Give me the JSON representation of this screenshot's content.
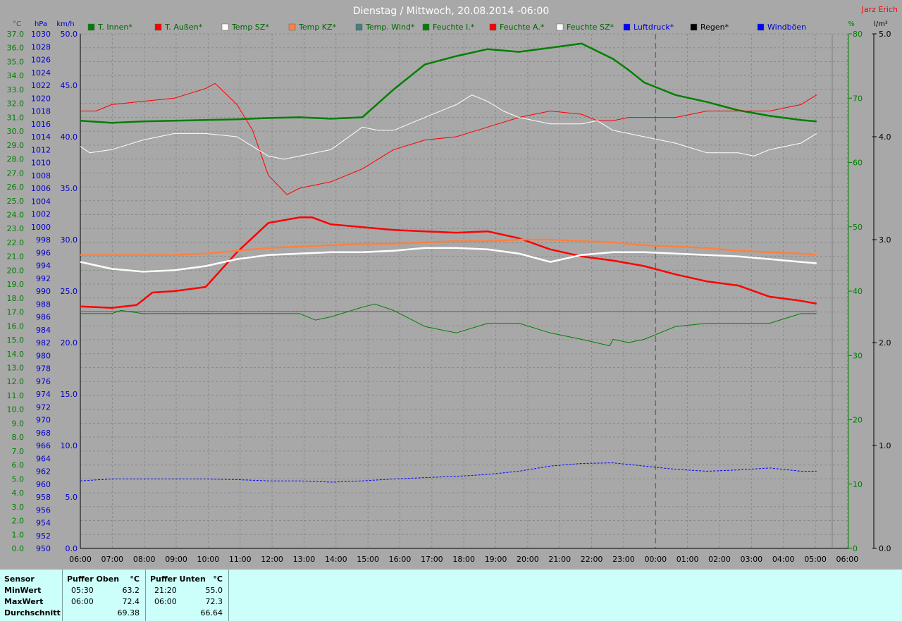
{
  "title": "Dienstag / Mittwoch, 20.08.2014  -06:00",
  "user": "Jarz Erich",
  "legend": [
    {
      "label": "T. Innen*",
      "color": "#008000"
    },
    {
      "label": "T. Außen*",
      "color": "#ff0000"
    },
    {
      "label": "Temp SZ*",
      "color": "#ffffff"
    },
    {
      "label": "Temp KZ*",
      "color": "#ff8040"
    },
    {
      "label": "Temp. Wind*",
      "color": "#408080"
    },
    {
      "label": "Feuchte I.*",
      "color": "#008000"
    },
    {
      "label": "Feuchte A.*",
      "color": "#ff0000"
    },
    {
      "label": "Feuchte SZ*",
      "color": "#ffffff"
    },
    {
      "label": "Luftdruck*",
      "color": "#0000ff"
    },
    {
      "label": "Regen*",
      "color": "#000000"
    },
    {
      "label": "Windböen",
      "color": "#0000ff"
    }
  ],
  "axes": {
    "temp_unit": "°C",
    "pressure_unit": "hPa",
    "wind_unit": "km/h",
    "humidity_unit": "%",
    "rain_unit": "l/m²",
    "temp_ticks": [
      "0.0",
      "1.0",
      "2.0",
      "3.0",
      "4.0",
      "5.0",
      "6.0",
      "7.0",
      "8.0",
      "9.0",
      "10.0",
      "11.0",
      "12.0",
      "13.0",
      "14.0",
      "15.0",
      "16.0",
      "17.0",
      "18.0",
      "19.0",
      "20.0",
      "21.0",
      "22.0",
      "23.0",
      "24.0",
      "25.0",
      "26.0",
      "27.0",
      "28.0",
      "29.0",
      "30.0",
      "31.0",
      "32.0",
      "33.0",
      "34.0",
      "35.0",
      "36.0",
      "37.0"
    ],
    "pressure_ticks": [
      "950",
      "952",
      "954",
      "956",
      "958",
      "960",
      "962",
      "964",
      "966",
      "968",
      "970",
      "972",
      "974",
      "976",
      "978",
      "980",
      "982",
      "984",
      "986",
      "988",
      "990",
      "992",
      "994",
      "996",
      "998",
      "1000",
      "1002",
      "1004",
      "1006",
      "1008",
      "1010",
      "1012",
      "1014",
      "1016",
      "1018",
      "1020",
      "1022",
      "1024",
      "1026",
      "1028",
      "1030"
    ],
    "wind_ticks": [
      "0.0",
      "5.0",
      "10.0",
      "15.0",
      "20.0",
      "25.0",
      "30.0",
      "35.0",
      "40.0",
      "45.0",
      "50.0"
    ],
    "humidity_ticks": [
      "0",
      "10",
      "20",
      "30",
      "40",
      "50",
      "60",
      "70",
      "80"
    ],
    "rain_ticks": [
      "0.0",
      "1.0",
      "2.0",
      "3.0",
      "4.0",
      "5.0"
    ],
    "time_ticks": [
      "06:00",
      "07:00",
      "08:00",
      "09:00",
      "10:00",
      "11:00",
      "12:00",
      "13:00",
      "14:00",
      "15:00",
      "16:00",
      "17:00",
      "18:00",
      "19:00",
      "20:00",
      "21:00",
      "22:00",
      "23:00",
      "00:00",
      "01:00",
      "02:00",
      "03:00",
      "04:00",
      "05:00",
      "06:00"
    ]
  },
  "chart_data": {
    "type": "line",
    "title": "Dienstag / Mittwoch, 20.08.2014  -06:00",
    "x_unit": "hours since 06:00",
    "xlim": [
      0,
      24
    ],
    "y_temp_lim": [
      0,
      37
    ],
    "y_pressure_lim": [
      950,
      1030
    ],
    "y_wind_lim": [
      0,
      50
    ],
    "y_humidity_lim": [
      0,
      80
    ],
    "y_rain_lim": [
      0,
      5
    ],
    "grid": true,
    "series": [
      {
        "name": "T. Innen*",
        "axis": "temp",
        "color": "#008000",
        "width": 2.5,
        "x": [
          0,
          1,
          2,
          3,
          4,
          5,
          6,
          7,
          8,
          9,
          10,
          11,
          12,
          13,
          14,
          15,
          16,
          17,
          17.5,
          18,
          19,
          20,
          21,
          22,
          23,
          23.5
        ],
        "y": [
          30.75,
          30.6,
          30.7,
          30.75,
          30.8,
          30.85,
          30.95,
          31.0,
          30.9,
          31.0,
          33.0,
          34.8,
          35.4,
          35.9,
          35.7,
          36.0,
          36.3,
          35.2,
          34.4,
          33.5,
          32.6,
          32.1,
          31.5,
          31.1,
          30.8,
          30.7
        ]
      },
      {
        "name": "T. Außen*",
        "axis": "temp",
        "color": "#ff0000",
        "width": 2.5,
        "x": [
          0,
          1,
          1.8,
          2.3,
          3,
          4,
          5,
          6,
          7,
          7.4,
          8,
          9,
          10,
          11,
          12,
          13,
          14,
          15,
          16,
          17,
          18,
          19,
          20,
          21,
          22,
          23,
          23.5
        ],
        "y": [
          17.4,
          17.3,
          17.5,
          18.4,
          18.5,
          18.8,
          21.3,
          23.4,
          23.8,
          23.8,
          23.3,
          23.1,
          22.9,
          22.8,
          22.7,
          22.8,
          22.3,
          21.5,
          21.0,
          20.7,
          20.3,
          19.7,
          19.2,
          18.9,
          18.1,
          17.8,
          17.6
        ]
      },
      {
        "name": "Temp SZ*",
        "axis": "temp",
        "color": "#ffffff",
        "width": 2.5,
        "x": [
          0,
          1,
          2,
          3,
          4,
          5,
          6,
          7,
          8,
          9,
          10,
          11,
          12,
          13,
          14,
          15,
          16,
          17,
          18,
          19,
          20,
          21,
          22,
          23,
          23.5
        ],
        "y": [
          20.6,
          20.1,
          19.9,
          20.0,
          20.3,
          20.8,
          21.1,
          21.2,
          21.3,
          21.3,
          21.4,
          21.6,
          21.6,
          21.5,
          21.2,
          20.6,
          21.1,
          21.3,
          21.3,
          21.2,
          21.1,
          21.0,
          20.8,
          20.6,
          20.5
        ]
      },
      {
        "name": "Temp KZ*",
        "axis": "temp",
        "color": "#ff8040",
        "width": 2.5,
        "x": [
          0,
          1,
          2,
          3,
          4,
          5,
          6,
          7,
          8,
          9,
          10,
          11,
          12,
          13,
          14,
          15,
          16,
          17,
          18,
          19,
          20,
          21,
          22,
          23,
          23.5
        ],
        "y": [
          21.1,
          21.1,
          21.1,
          21.1,
          21.2,
          21.4,
          21.6,
          21.7,
          21.8,
          21.9,
          21.9,
          22.0,
          22.1,
          22.1,
          22.2,
          22.2,
          22.1,
          22.0,
          21.8,
          21.7,
          21.6,
          21.4,
          21.3,
          21.2,
          21.1
        ]
      },
      {
        "name": "Temp. Wind*",
        "axis": "temp",
        "color": "#408080",
        "width": 1,
        "x": [
          0,
          23.5
        ],
        "y": [
          17.05,
          17.05
        ]
      },
      {
        "name": "Feuchte I.*",
        "axis": "humidity",
        "color": "#008000",
        "width": 1,
        "x": [
          0,
          1,
          1.3,
          2,
          4,
          6,
          7,
          7.5,
          8,
          9,
          9.4,
          10,
          11,
          12,
          13,
          14,
          15,
          16,
          16.9,
          17,
          17.5,
          18,
          19,
          20,
          21,
          22,
          23,
          23.5
        ],
        "y": [
          36.5,
          36.5,
          37.0,
          36.5,
          36.5,
          36.5,
          36.5,
          35.5,
          36.0,
          37.5,
          38.0,
          37.0,
          34.5,
          33.5,
          35.0,
          35.0,
          33.5,
          32.5,
          31.5,
          32.5,
          32.0,
          32.5,
          34.5,
          35.0,
          35.0,
          35.0,
          36.5,
          36.5
        ]
      },
      {
        "name": "Feuchte A.*",
        "axis": "humidity",
        "color": "#ff0000",
        "width": 1,
        "x": [
          0,
          0.5,
          1,
          2,
          3,
          4,
          4.3,
          5,
          5.5,
          6,
          6.6,
          7,
          8,
          9,
          10,
          11,
          12,
          13,
          14,
          15,
          16,
          16.5,
          17,
          17.5,
          18,
          19,
          20,
          21,
          22,
          23,
          23.5
        ],
        "y": [
          68.0,
          68.0,
          69.0,
          69.5,
          70.0,
          71.5,
          72.3,
          69.0,
          65.0,
          58.0,
          55.0,
          56.0,
          57.0,
          59.0,
          62.0,
          63.5,
          64.0,
          65.5,
          67.0,
          68.0,
          67.5,
          66.5,
          66.5,
          67.0,
          67.0,
          67.0,
          68.0,
          68.0,
          68.0,
          69.0,
          70.5
        ]
      },
      {
        "name": "Feuchte SZ*",
        "axis": "humidity",
        "color": "#ffffff",
        "width": 1,
        "x": [
          0,
          0.3,
          1,
          2,
          3,
          4,
          5,
          6,
          6.5,
          7,
          8,
          9,
          9.5,
          10,
          11,
          12,
          12.5,
          13,
          13.5,
          14,
          15,
          16,
          16.5,
          17,
          17.5,
          18,
          19,
          20,
          21,
          21.5,
          22,
          23,
          23.5
        ],
        "y": [
          62.5,
          61.5,
          62.0,
          63.5,
          64.5,
          64.5,
          64.0,
          61.0,
          60.5,
          61.0,
          62.0,
          65.5,
          65.0,
          65.0,
          67.0,
          69.0,
          70.5,
          69.5,
          68.0,
          67.0,
          66.0,
          66.0,
          66.5,
          65.0,
          64.5,
          64.0,
          63.0,
          61.5,
          61.5,
          61.0,
          62.0,
          63.0,
          64.5
        ]
      },
      {
        "name": "Luftdruck*",
        "axis": "pressure",
        "color": "#0000ff",
        "width": 1,
        "dashed": true,
        "x": [
          0,
          1,
          2,
          3,
          4,
          5,
          6,
          7,
          8,
          9,
          10,
          11,
          12,
          13,
          14,
          15,
          16,
          17,
          18,
          19,
          20,
          21,
          22,
          23,
          23.5
        ],
        "y": [
          960.5,
          960.8,
          960.8,
          960.8,
          960.8,
          960.7,
          960.5,
          960.5,
          960.3,
          960.5,
          960.8,
          961.0,
          961.2,
          961.5,
          962.0,
          962.8,
          963.2,
          963.3,
          962.8,
          962.3,
          962.0,
          962.2,
          962.5,
          962.0,
          962.0
        ]
      }
    ]
  },
  "stats": {
    "header_sensor": "Sensor",
    "row_labels": [
      "MinWert",
      "MaxWert",
      "Durchschnitt"
    ],
    "buffers": [
      {
        "name": "Puffer Oben",
        "unit": "°C",
        "min_time": "05:30",
        "min": "63.2",
        "max_time": "06:00",
        "max": "72.4",
        "avg": "69.38"
      },
      {
        "name": "Puffer Unten",
        "unit": "°C",
        "min_time": "21:20",
        "min": "55.0",
        "max_time": "06:00",
        "max": "72.3",
        "avg": "66.64"
      }
    ]
  }
}
